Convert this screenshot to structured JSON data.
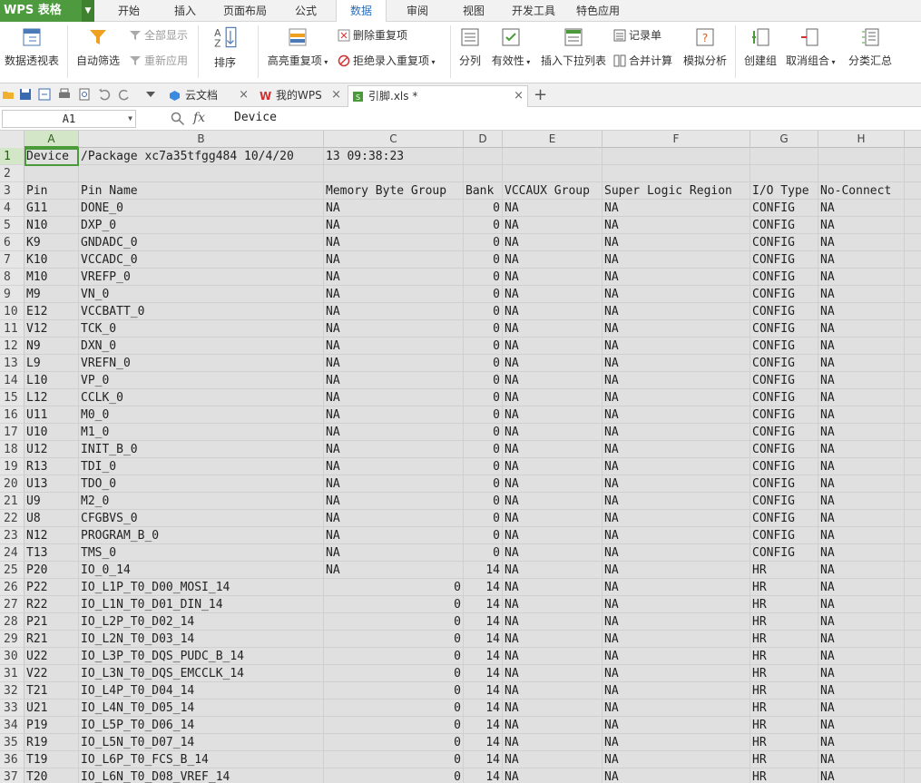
{
  "app": {
    "logo": "WPS 表格"
  },
  "menu": [
    "开始",
    "插入",
    "页面布局",
    "公式",
    "数据",
    "审阅",
    "视图",
    "开发工具",
    "特色应用"
  ],
  "ribbon": {
    "pivot": "数据透视表",
    "autofilter": "自动筛选",
    "show_all": "全部显示",
    "reapply": "重新应用",
    "sort": "排序",
    "highlight_dup": "高亮重复项",
    "remove_dup": "删除重复项",
    "reject_dup": "拒绝录入重复项",
    "split": "分列",
    "validity": "有效性",
    "insert_dropdown": "插入下拉列表",
    "record": "记录单",
    "consolidate": "合并计算",
    "whatif": "模拟分析",
    "group": "创建组",
    "ungroup": "取消组合",
    "subtotal": "分类汇总"
  },
  "tabs": [
    {
      "label": "云文档"
    },
    {
      "label": "我的WPS"
    },
    {
      "label": "引脚.xls *"
    }
  ],
  "namebox": "A1",
  "formula": "Device",
  "columns": [
    "A",
    "B",
    "C",
    "D",
    "E",
    "F",
    "G",
    "H"
  ],
  "rows": [
    {
      "n": "1",
      "a": "Device",
      "b": "/Package xc7a35tfgg484 10/4/20",
      "c": "13 09:38:23",
      "d": "",
      "e": "",
      "f": "",
      "g": "",
      "h": ""
    },
    {
      "n": "2",
      "a": "",
      "b": "",
      "c": "",
      "d": "",
      "e": "",
      "f": "",
      "g": "",
      "h": ""
    },
    {
      "n": "3",
      "a": "Pin",
      "b": "Pin Name",
      "c": "Memory Byte Group",
      "d": "Bank",
      "e": "VCCAUX Group",
      "f": "Super Logic Region",
      "g": "I/O Type",
      "h": "No-Connect"
    },
    {
      "n": "4",
      "a": "G11",
      "b": "DONE_0",
      "c": "NA",
      "d": "0",
      "e": "NA",
      "f": "NA",
      "g": "CONFIG",
      "h": "NA"
    },
    {
      "n": "5",
      "a": "N10",
      "b": "DXP_0",
      "c": "NA",
      "d": "0",
      "e": "NA",
      "f": "NA",
      "g": "CONFIG",
      "h": "NA"
    },
    {
      "n": "6",
      "a": "K9",
      "b": "GNDADC_0",
      "c": "NA",
      "d": "0",
      "e": "NA",
      "f": "NA",
      "g": "CONFIG",
      "h": "NA"
    },
    {
      "n": "7",
      "a": "K10",
      "b": "VCCADC_0",
      "c": "NA",
      "d": "0",
      "e": "NA",
      "f": "NA",
      "g": "CONFIG",
      "h": "NA"
    },
    {
      "n": "8",
      "a": "M10",
      "b": "VREFP_0",
      "c": "NA",
      "d": "0",
      "e": "NA",
      "f": "NA",
      "g": "CONFIG",
      "h": "NA"
    },
    {
      "n": "9",
      "a": "M9",
      "b": "VN_0",
      "c": "NA",
      "d": "0",
      "e": "NA",
      "f": "NA",
      "g": "CONFIG",
      "h": "NA"
    },
    {
      "n": "10",
      "a": "E12",
      "b": "VCCBATT_0",
      "c": "NA",
      "d": "0",
      "e": "NA",
      "f": "NA",
      "g": "CONFIG",
      "h": "NA"
    },
    {
      "n": "11",
      "a": "V12",
      "b": "TCK_0",
      "c": "NA",
      "d": "0",
      "e": "NA",
      "f": "NA",
      "g": "CONFIG",
      "h": "NA"
    },
    {
      "n": "12",
      "a": "N9",
      "b": "DXN_0",
      "c": "NA",
      "d": "0",
      "e": "NA",
      "f": "NA",
      "g": "CONFIG",
      "h": "NA"
    },
    {
      "n": "13",
      "a": "L9",
      "b": "VREFN_0",
      "c": "NA",
      "d": "0",
      "e": "NA",
      "f": "NA",
      "g": "CONFIG",
      "h": "NA"
    },
    {
      "n": "14",
      "a": "L10",
      "b": "VP_0",
      "c": "NA",
      "d": "0",
      "e": "NA",
      "f": "NA",
      "g": "CONFIG",
      "h": "NA"
    },
    {
      "n": "15",
      "a": "L12",
      "b": "CCLK_0",
      "c": "NA",
      "d": "0",
      "e": "NA",
      "f": "NA",
      "g": "CONFIG",
      "h": "NA"
    },
    {
      "n": "16",
      "a": "U11",
      "b": "M0_0",
      "c": "NA",
      "d": "0",
      "e": "NA",
      "f": "NA",
      "g": "CONFIG",
      "h": "NA"
    },
    {
      "n": "17",
      "a": "U10",
      "b": "M1_0",
      "c": "NA",
      "d": "0",
      "e": "NA",
      "f": "NA",
      "g": "CONFIG",
      "h": "NA"
    },
    {
      "n": "18",
      "a": "U12",
      "b": "INIT_B_0",
      "c": "NA",
      "d": "0",
      "e": "NA",
      "f": "NA",
      "g": "CONFIG",
      "h": "NA"
    },
    {
      "n": "19",
      "a": "R13",
      "b": "TDI_0",
      "c": "NA",
      "d": "0",
      "e": "NA",
      "f": "NA",
      "g": "CONFIG",
      "h": "NA"
    },
    {
      "n": "20",
      "a": "U13",
      "b": "TDO_0",
      "c": "NA",
      "d": "0",
      "e": "NA",
      "f": "NA",
      "g": "CONFIG",
      "h": "NA"
    },
    {
      "n": "21",
      "a": "U9",
      "b": "M2_0",
      "c": "NA",
      "d": "0",
      "e": "NA",
      "f": "NA",
      "g": "CONFIG",
      "h": "NA"
    },
    {
      "n": "22",
      "a": "U8",
      "b": "CFGBVS_0",
      "c": "NA",
      "d": "0",
      "e": "NA",
      "f": "NA",
      "g": "CONFIG",
      "h": "NA"
    },
    {
      "n": "23",
      "a": "N12",
      "b": "PROGRAM_B_0",
      "c": "NA",
      "d": "0",
      "e": "NA",
      "f": "NA",
      "g": "CONFIG",
      "h": "NA"
    },
    {
      "n": "24",
      "a": "T13",
      "b": "TMS_0",
      "c": "NA",
      "d": "0",
      "e": "NA",
      "f": "NA",
      "g": "CONFIG",
      "h": "NA"
    },
    {
      "n": "25",
      "a": "P20",
      "b": "IO_0_14",
      "c": "NA",
      "d": "14",
      "e": "NA",
      "f": "NA",
      "g": "HR",
      "h": "NA"
    },
    {
      "n": "26",
      "a": "P22",
      "b": "IO_L1P_T0_D00_MOSI_14",
      "c": "0",
      "d": "14",
      "e": "NA",
      "f": "NA",
      "g": "HR",
      "h": "NA"
    },
    {
      "n": "27",
      "a": "R22",
      "b": "IO_L1N_T0_D01_DIN_14",
      "c": "0",
      "d": "14",
      "e": "NA",
      "f": "NA",
      "g": "HR",
      "h": "NA"
    },
    {
      "n": "28",
      "a": "P21",
      "b": "IO_L2P_T0_D02_14",
      "c": "0",
      "d": "14",
      "e": "NA",
      "f": "NA",
      "g": "HR",
      "h": "NA"
    },
    {
      "n": "29",
      "a": "R21",
      "b": "IO_L2N_T0_D03_14",
      "c": "0",
      "d": "14",
      "e": "NA",
      "f": "NA",
      "g": "HR",
      "h": "NA"
    },
    {
      "n": "30",
      "a": "U22",
      "b": "IO_L3P_T0_DQS_PUDC_B_14",
      "c": "0",
      "d": "14",
      "e": "NA",
      "f": "NA",
      "g": "HR",
      "h": "NA"
    },
    {
      "n": "31",
      "a": "V22",
      "b": "IO_L3N_T0_DQS_EMCCLK_14",
      "c": "0",
      "d": "14",
      "e": "NA",
      "f": "NA",
      "g": "HR",
      "h": "NA"
    },
    {
      "n": "32",
      "a": "T21",
      "b": "IO_L4P_T0_D04_14",
      "c": "0",
      "d": "14",
      "e": "NA",
      "f": "NA",
      "g": "HR",
      "h": "NA"
    },
    {
      "n": "33",
      "a": "U21",
      "b": "IO_L4N_T0_D05_14",
      "c": "0",
      "d": "14",
      "e": "NA",
      "f": "NA",
      "g": "HR",
      "h": "NA"
    },
    {
      "n": "34",
      "a": "P19",
      "b": "IO_L5P_T0_D06_14",
      "c": "0",
      "d": "14",
      "e": "NA",
      "f": "NA",
      "g": "HR",
      "h": "NA"
    },
    {
      "n": "35",
      "a": "R19",
      "b": "IO_L5N_T0_D07_14",
      "c": "0",
      "d": "14",
      "e": "NA",
      "f": "NA",
      "g": "HR",
      "h": "NA"
    },
    {
      "n": "36",
      "a": "T19",
      "b": "IO_L6P_T0_FCS_B_14",
      "c": "0",
      "d": "14",
      "e": "NA",
      "f": "NA",
      "g": "HR",
      "h": "NA"
    },
    {
      "n": "37",
      "a": "T20",
      "b": "IO_L6N_T0_D08_VREF_14",
      "c": "0",
      "d": "14",
      "e": "NA",
      "f": "NA",
      "g": "HR",
      "h": "NA"
    }
  ]
}
